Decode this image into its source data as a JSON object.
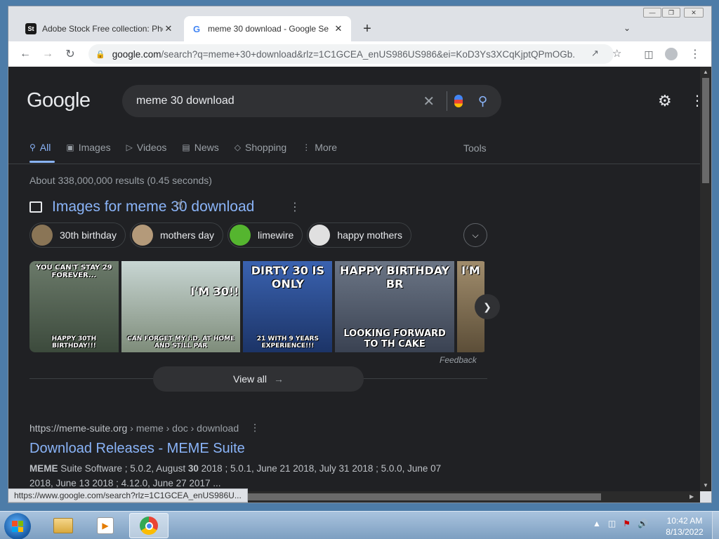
{
  "tabs": [
    {
      "favicon": "St",
      "title": "Adobe Stock Free collection: Pho",
      "close": "✕"
    },
    {
      "favicon": "G",
      "title": "meme 30 download - Google Se",
      "close": "✕"
    }
  ],
  "new_tab_label": "+",
  "address_bar": {
    "host": "google.com",
    "rest": "/search?q=meme+30+download&rlz=1C1GCEA_enUS986US986&ei=KoD3Ys3XCqKjptQPmOGb..."
  },
  "google": {
    "logo": "Google",
    "query": "meme 30 download",
    "nav": [
      {
        "icon": "search-icon",
        "label": "All"
      },
      {
        "icon": "image-icon",
        "label": "Images"
      },
      {
        "icon": "play-icon",
        "label": "Videos"
      },
      {
        "icon": "news-icon",
        "label": "News"
      },
      {
        "icon": "tag-icon",
        "label": "Shopping"
      },
      {
        "icon": "more-dots-icon",
        "label": "More"
      }
    ],
    "tools": "Tools",
    "stats": "About 338,000,000 results (0.45 seconds)",
    "images_heading": "Images for meme 30 download",
    "chips": [
      {
        "label": "30th birthday",
        "color": "#8a7556"
      },
      {
        "label": "mothers day",
        "color": "#b49a7a"
      },
      {
        "label": "limewire",
        "color": "#55b52f"
      },
      {
        "label": "happy mothers",
        "color": "#e0e0e0"
      }
    ],
    "thumbnails": [
      {
        "top": "YOU CAN'T STAY 29 FOREVER...",
        "bottom": "HAPPY 30TH BIRTHDAY!!!",
        "bg": "#4b5a4a",
        "width": 130
      },
      {
        "top": "I'M 30!!",
        "bottom": "CAN FORGET MY I.D. AT HOME AND STILL PAR",
        "bg": "#a8b7b4",
        "width": 174
      },
      {
        "top": "DIRTY 30 IS ONLY",
        "bottom": "21 WITH 9 YEARS EXPERIENCE!!!",
        "bg": "#2c4c8c",
        "width": 130
      },
      {
        "top": "HAPPY BIRTHDAY BR",
        "bottom": "LOOKING FORWARD TO TH CAKE",
        "bg": "#556070",
        "width": 174
      },
      {
        "top": "I'M",
        "bottom": "",
        "bg": "#8b7b5b",
        "width": 40
      }
    ],
    "feedback": "Feedback",
    "view_all": "View all",
    "result": {
      "site": "https://meme-suite.org",
      "path": "› meme › doc › download",
      "title": "Download Releases - MEME Suite",
      "snippet_bold": "MEME",
      "snippet_a": " Suite Software ; 5.0.2, August ",
      "snippet_bold2": "30",
      "snippet_b": " 2018 ; 5.0.1, June 21 2018, July 31 2018 ; 5.0.0, June 07 2018, June 13 2018 ; 4.12.0, June 27 2017 ..."
    }
  },
  "status_url": "https://www.google.com/search?rlz=1C1GCEA_enUS986U...",
  "taskbar": {
    "clock_time": "10:42 AM",
    "clock_date": "8/13/2022"
  }
}
